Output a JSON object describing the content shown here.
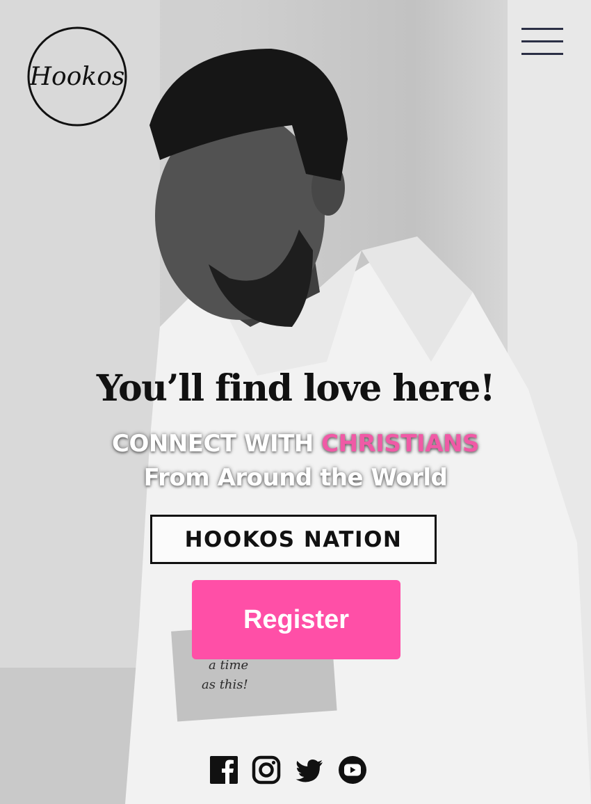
{
  "header": {
    "logo_text": "Hookos",
    "menu_icon": "hamburger-menu-icon"
  },
  "hero": {
    "headline": "You’ll find love here!",
    "subline_part1": "CONNECT WITH ",
    "subline_accent": "CHRISTIANS",
    "subline2": "From Around the World",
    "badge": "HOOKOS NATION",
    "register_label": "Register",
    "shirt_print": [
      "a time",
      "as this!"
    ]
  },
  "social": [
    {
      "name": "facebook",
      "icon": "facebook-icon"
    },
    {
      "name": "instagram",
      "icon": "instagram-icon"
    },
    {
      "name": "twitter",
      "icon": "twitter-icon"
    },
    {
      "name": "youtube",
      "icon": "youtube-icon"
    }
  ],
  "colors": {
    "accent_pink": "#ff4fa7",
    "subline_pink": "#f05aa6",
    "text_dark": "#111111",
    "menu_lines": "#2b2f45"
  }
}
